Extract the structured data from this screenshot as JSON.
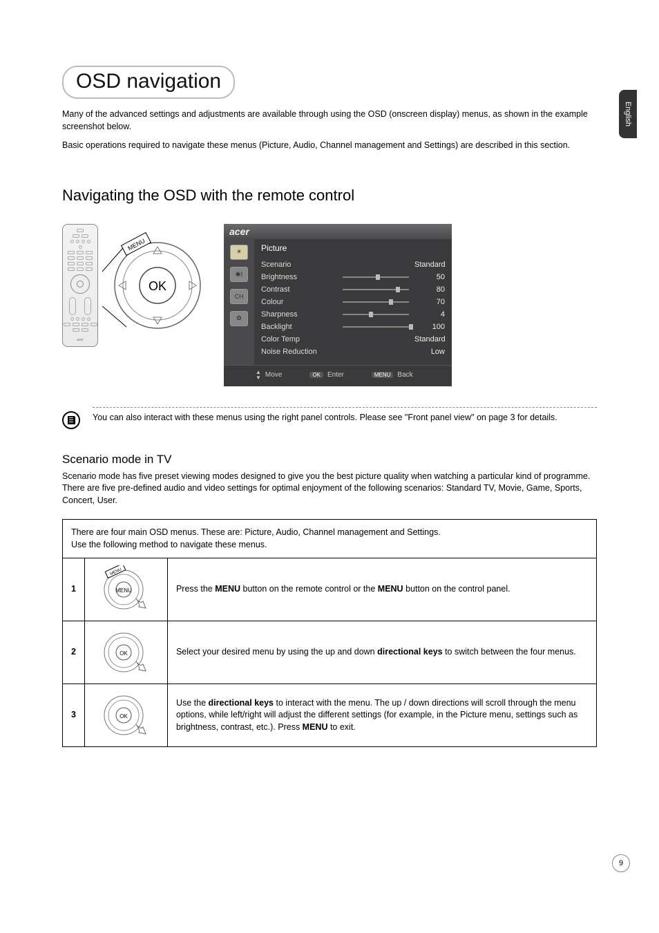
{
  "sidebar": {
    "language": "English"
  },
  "title": "OSD navigation",
  "intro": {
    "p1": "Many of the advanced settings and adjustments are available through using the OSD (onscreen display) menus, as shown in the example screenshot below.",
    "p2": "Basic operations required to navigate these menus (Picture, Audio, Channel management and Settings) are described in this section."
  },
  "section_heading": "Navigating the OSD with the remote control",
  "remote": {
    "menu_label": "MENU",
    "ok_label": "OK",
    "brand": "acer"
  },
  "osd": {
    "brand": "acer",
    "menu_title": "Picture",
    "icons": {
      "ch_label": "CH"
    },
    "rows": [
      {
        "label": "Scenario",
        "value": "Standard",
        "slider": null
      },
      {
        "label": "Brightness",
        "value": "50",
        "slider": 50
      },
      {
        "label": "Contrast",
        "value": "80",
        "slider": 80
      },
      {
        "label": "Colour",
        "value": "70",
        "slider": 70
      },
      {
        "label": "Sharpness",
        "value": "4",
        "slider": 40
      },
      {
        "label": "Backlight",
        "value": "100",
        "slider": 100
      },
      {
        "label": "Color Temp",
        "value": "Standard",
        "slider": null
      },
      {
        "label": "Noise Reduction",
        "value": "Low",
        "slider": null
      }
    ],
    "footer": {
      "move": "Move",
      "ok": "OK",
      "enter": "Enter",
      "menu": "MENU",
      "back": "Back"
    }
  },
  "note": {
    "text": "You can also interact with these menus using the right panel controls. Please see \"Front panel view\" on page 3 for details."
  },
  "scenario": {
    "heading": "Scenario mode in TV",
    "text": "Scenario mode has five preset viewing modes designed to give you the best picture quality when watching a particular kind of programme. There are five pre-defined audio and video settings for optimal enjoyment of the following scenarios: Standard TV, Movie, Game, Sports, Concert, User."
  },
  "table": {
    "intro_l1": "There are four main OSD menus. These are: Picture, Audio, Channel management and Settings.",
    "intro_l2": "Use the following method to navigate these menus.",
    "steps": [
      {
        "num": "1",
        "desc_pre": "Press the ",
        "desc_b1": "MENU",
        "desc_mid1": " button on the remote control or the ",
        "desc_b2": "MENU",
        "desc_post": " button on the control panel.",
        "icon_label": "MENU"
      },
      {
        "num": "2",
        "desc_pre": "Select your desired menu by using the up and down ",
        "desc_b1": "directional keys",
        "desc_post": " to switch between the four menus.",
        "icon_label": "OK"
      },
      {
        "num": "3",
        "desc_pre": "Use the ",
        "desc_b1": "directional keys",
        "desc_mid1": " to interact with the menu. The up / down directions will scroll through the menu options, while left/right will adjust the different settings (for example, in the Picture menu, settings such as brightness, contrast, etc.). Press ",
        "desc_b2": "MENU",
        "desc_post": " to exit.",
        "icon_label": "OK"
      }
    ]
  },
  "page_number": "9"
}
